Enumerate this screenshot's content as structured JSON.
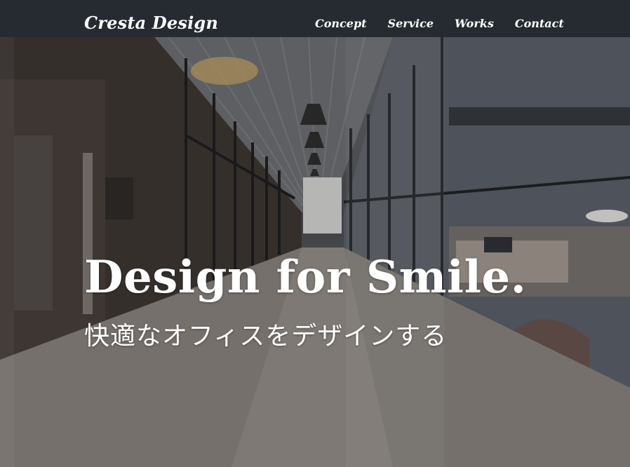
{
  "header": {
    "logo": "Cresta Design",
    "nav": [
      "Concept",
      "Service",
      "Works",
      "Contact"
    ]
  },
  "hero": {
    "headline": "Design for Smile.",
    "subline": "快適なオフィスをデザインする"
  },
  "colors": {
    "header_bg": "#252b31",
    "text": "#ffffff"
  }
}
